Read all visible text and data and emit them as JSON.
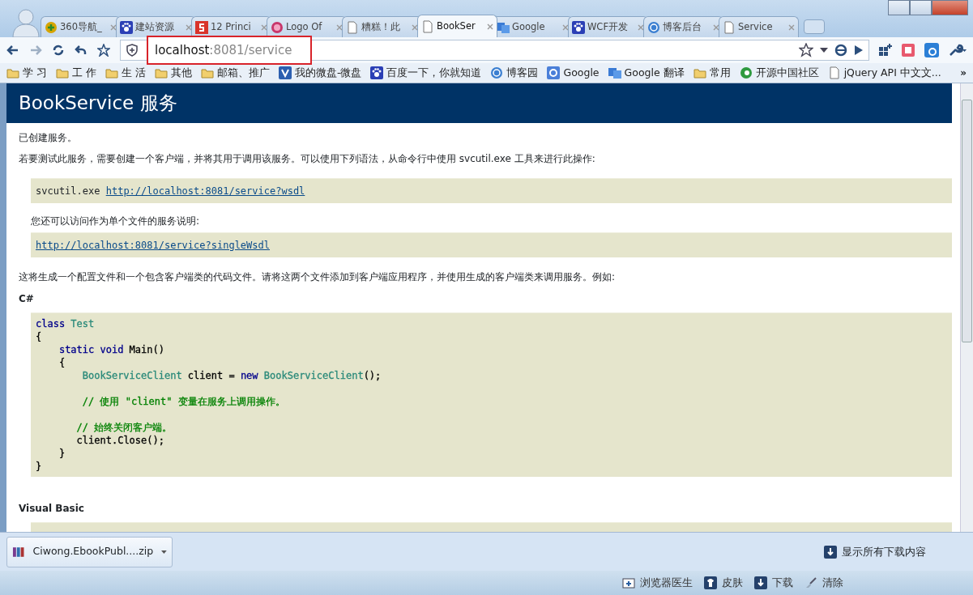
{
  "tabs": [
    {
      "title": "360导航_",
      "selected": false
    },
    {
      "title": "建站资源",
      "selected": false
    },
    {
      "title": "12 Princi",
      "selected": false
    },
    {
      "title": "Logo Of",
      "selected": false
    },
    {
      "title": "糟糕！此",
      "selected": false
    },
    {
      "title": "BookSer",
      "selected": true
    },
    {
      "title": "Google",
      "selected": false
    },
    {
      "title": "WCF开发",
      "selected": false
    },
    {
      "title": "博客后台",
      "selected": false
    },
    {
      "title": "Service",
      "selected": false
    }
  ],
  "address": {
    "host": "localhost",
    "path": ":8081/service"
  },
  "bookmarks": [
    "学 习",
    "工 作",
    "生 活",
    "其他",
    "邮箱、推广",
    "我的微盘-微盘",
    "百度一下，你就知道",
    "博客园",
    "Google",
    "Google 翻译",
    "常用",
    "开源中国社区",
    "jQuery API 中文文..."
  ],
  "bookmarks_more": "»",
  "page": {
    "heading": "BookService 服务",
    "intro": "已创建服务。",
    "instructions": "若要测试此服务，需要创建一个客户端，并将其用于调用该服务。可以使用下列语法，从命令行中使用 svcutil.exe 工具来进行此操作:",
    "command": "svcutil.exe",
    "wsdl_link": "http://localhost:8081/service?wsdl",
    "single_note": "您还可以访问作为单个文件的服务说明:",
    "single_link": "http://localhost:8081/service?singleWsdl",
    "explain": "这将生成一个配置文件和一个包含客户端类的代码文件。请将这两个文件添加到客户端应用程序，并使用生成的客户端类来调用服务。例如:",
    "csharp_label": "C#",
    "code": [
      {
        "tokens": [
          {
            "t": "class ",
            "color": "#00008b"
          },
          {
            "t": "Test",
            "color": "#2b8a7a"
          }
        ]
      },
      {
        "tokens": [
          {
            "t": "{",
            "color": "#000000"
          }
        ]
      },
      {
        "tokens": [
          {
            "t": "    static void ",
            "color": "#00008b"
          },
          {
            "t": "Main()",
            "color": "#000000"
          }
        ]
      },
      {
        "tokens": [
          {
            "t": "    {",
            "color": "#000000"
          }
        ]
      },
      {
        "tokens": [
          {
            "t": "        BookServiceClient",
            "color": "#2b8a7a"
          },
          {
            "t": " client = ",
            "color": "#000000"
          },
          {
            "t": "new ",
            "color": "#00008b"
          },
          {
            "t": "BookServiceClient",
            "color": "#2b8a7a"
          },
          {
            "t": "();",
            "color": "#000000"
          }
        ]
      },
      {
        "space_before": true,
        "tokens": [
          {
            "t": "        // 使用 \"client\" 变量在服务上调用操作。",
            "color": "#008000"
          }
        ]
      },
      {
        "space_before": true,
        "tokens": [
          {
            "t": "       // 始终关闭客户端。",
            "color": "#008000"
          }
        ]
      },
      {
        "tokens": [
          {
            "t": "       client.Close();",
            "color": "#000000"
          }
        ]
      },
      {
        "tokens": [
          {
            "t": "    }",
            "color": "#000000"
          }
        ]
      },
      {
        "tokens": [
          {
            "t": "}",
            "color": "#000000"
          }
        ]
      }
    ],
    "vb_label": "Visual Basic"
  },
  "download": {
    "file": "Ciwong.EbookPubl....zip",
    "show_all": "显示所有下载内容"
  },
  "status_bar": [
    "浏览器医生",
    "皮肤",
    "下载",
    "清除"
  ]
}
